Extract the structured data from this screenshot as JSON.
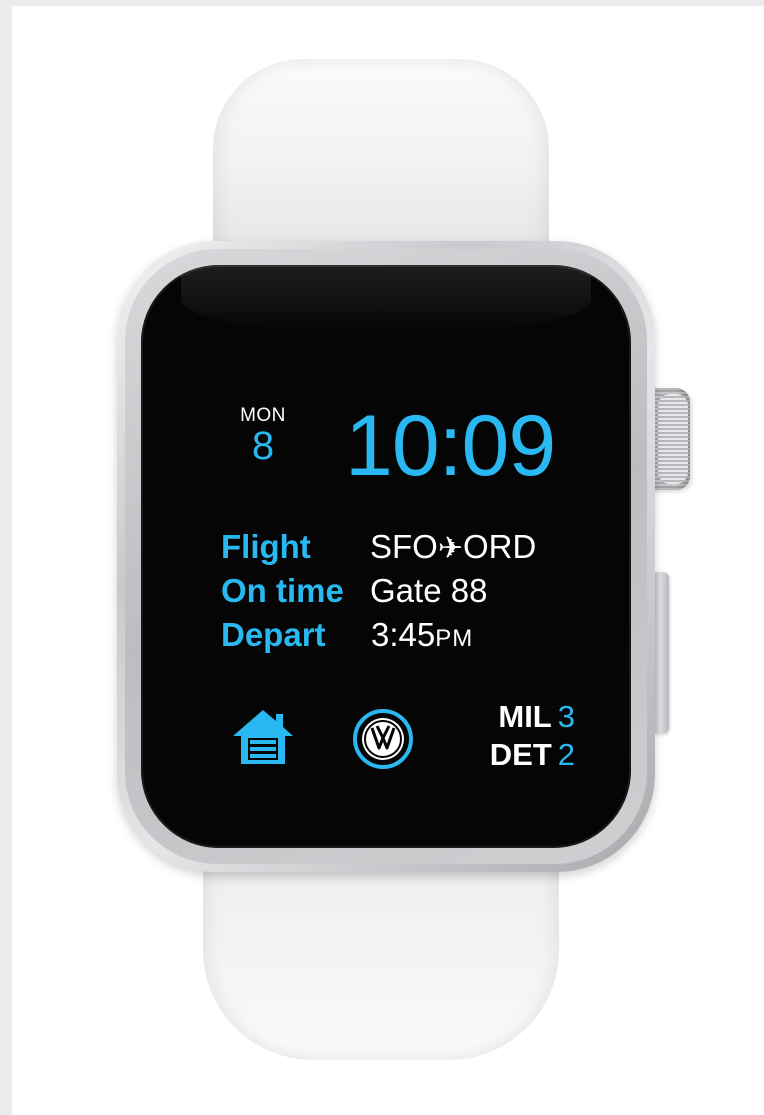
{
  "watch_face": {
    "date": {
      "weekday": "MON",
      "day": "8"
    },
    "time": "10:09",
    "flight": [
      {
        "label": "Flight",
        "value_from": "SFO",
        "value_arrow": "✈",
        "value_to": "ORD"
      },
      {
        "label": "On time",
        "value": "Gate 88"
      },
      {
        "label": "Depart",
        "value_time": "3:45",
        "value_suffix": "PM"
      }
    ],
    "complications": {
      "home_icon": "garage-home-icon",
      "vw_icon": "vw-logo-icon",
      "scores": [
        {
          "team": "MIL",
          "score": "3"
        },
        {
          "team": "DET",
          "score": "2"
        }
      ]
    }
  },
  "colors": {
    "accent": "#2ab8f2",
    "screen": "#050505",
    "text": "#ffffff"
  }
}
